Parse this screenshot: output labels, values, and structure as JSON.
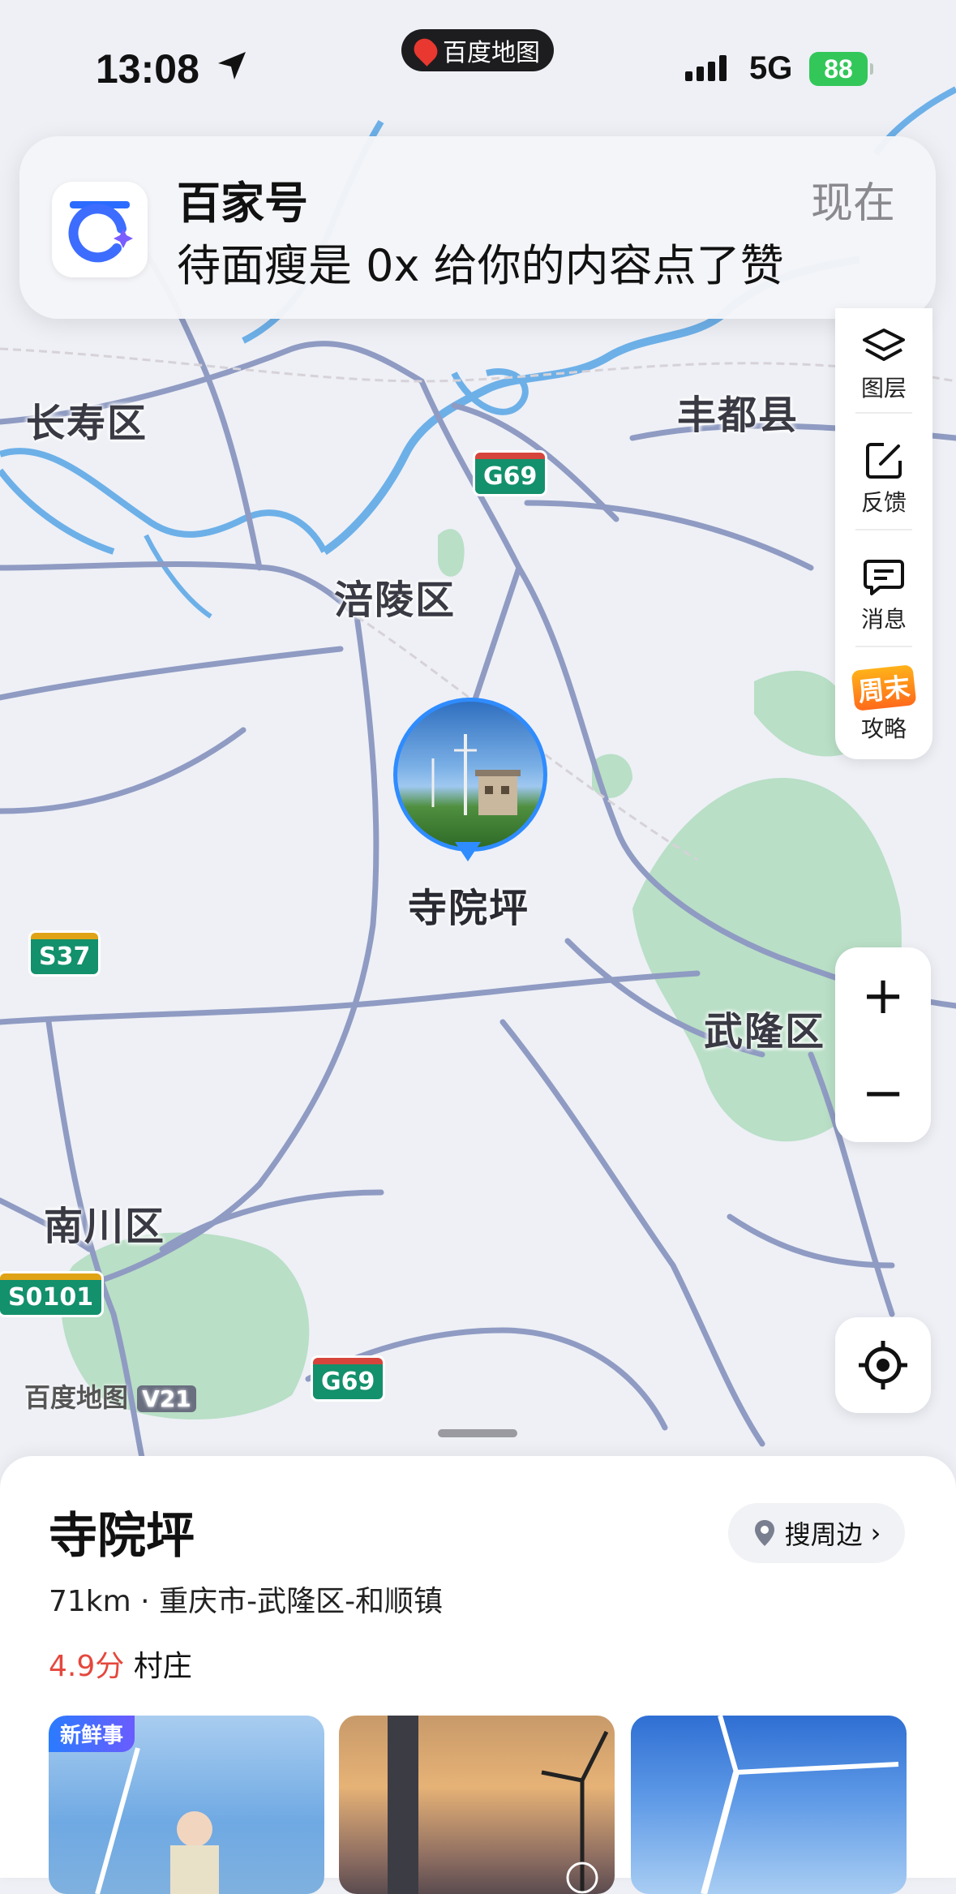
{
  "status_bar": {
    "time": "13:08",
    "app_pill": "百度地图",
    "network": "5G",
    "battery": "88"
  },
  "notification": {
    "app_name": "百家号",
    "time": "现在",
    "message": "待面瘦是 0x 给你的内容点了赞"
  },
  "map": {
    "place_labels": [
      "长寿区",
      "丰都县",
      "涪陵区",
      "武隆区",
      "南川区"
    ],
    "road_shields": [
      "G69",
      "S37",
      "S0101",
      "G69"
    ],
    "poi_label": "寺院坪",
    "logo_text": "百度地图",
    "logo_version": "V21",
    "colors": {
      "water": "#6db0e8",
      "road": "#8f9bc2",
      "green": "#b9dfc6",
      "accent": "#2f8cff"
    }
  },
  "side_panel": {
    "items": [
      {
        "label": "图层",
        "icon": "layers-icon"
      },
      {
        "label": "反馈",
        "icon": "edit-icon"
      },
      {
        "label": "消息",
        "icon": "message-icon"
      },
      {
        "label": "攻略",
        "icon": "weekend-guide-icon",
        "badge": "周末"
      }
    ]
  },
  "zoom": {
    "in": "+",
    "out": "−"
  },
  "sheet": {
    "title": "寺院坪",
    "nearby_button": "搜周边",
    "distance": "71km",
    "address": "重庆市-武隆区-和顺镇",
    "score": "4.9分",
    "category": "村庄",
    "photo_badge": "新鲜事"
  }
}
